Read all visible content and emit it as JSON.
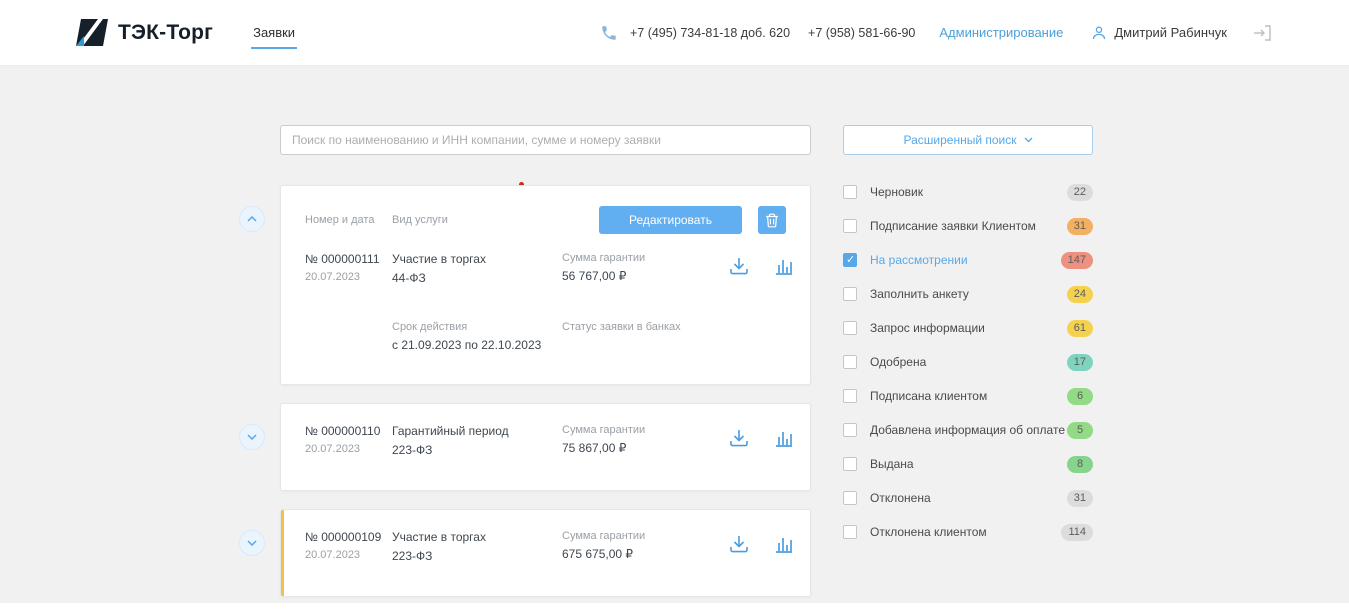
{
  "header": {
    "logo_text": "ТЭК-Торг",
    "nav_requests": "Заявки",
    "phone_1": "+7 (495) 734-81-18 доб. 620",
    "phone_2": "+7 (958) 581-66-90",
    "admin_link": "Администрирование",
    "user_name": "Дмитрий Рабинчук"
  },
  "search": {
    "placeholder": "Поиск по наименованию и ИНН компании, сумме и номеру заявки",
    "advanced_label": "Расширенный поиск"
  },
  "cards": [
    {
      "labels": {
        "number_date": "Номер и дата",
        "service_type": "Вид услуги"
      },
      "edit_label": "Редактировать",
      "number": "№ 000000111",
      "date": "20.07.2023",
      "service": "Участие в торгах",
      "law": "44-ФЗ",
      "sum_label": "Сумма гарантии",
      "sum": "56 767,00 ₽",
      "validity_label": "Срок действия",
      "validity": "с 21.09.2023 по 22.10.2023",
      "bank_status_label": "Статус заявки в банках"
    },
    {
      "number": "№ 000000110",
      "date": "20.07.2023",
      "service": "Гарантийный период",
      "law": "223-ФЗ",
      "sum_label": "Сумма гарантии",
      "sum": "75 867,00 ₽"
    },
    {
      "number": "№ 000000109",
      "date": "20.07.2023",
      "service": "Участие в торгах",
      "law": "223-ФЗ",
      "sum_label": "Сумма гарантии",
      "sum": "675 675,00 ₽",
      "accent_color": "#f0c24b"
    }
  ],
  "filters": {
    "items": [
      {
        "label": "Черновик",
        "count": "22",
        "badge_color": "#dcdcdc",
        "checked": false
      },
      {
        "label": "Подписание заявки Клиентом",
        "count": "31",
        "badge_color": "#f3b061",
        "checked": false
      },
      {
        "label": "На рассмотрении",
        "count": "147",
        "badge_color": "#ef9180",
        "checked": true
      },
      {
        "label": "Заполнить анкету",
        "count": "24",
        "badge_color": "#f5d24e",
        "checked": false
      },
      {
        "label": "Запрос информации",
        "count": "61",
        "badge_color": "#f5d24e",
        "checked": false
      },
      {
        "label": "Одобрена",
        "count": "17",
        "badge_color": "#7fd4bf",
        "checked": false
      },
      {
        "label": "Подписана клиентом",
        "count": "6",
        "badge_color": "#92da85",
        "checked": false
      },
      {
        "label": "Добавлена информация об оплате",
        "count": "5",
        "badge_color": "#92da85",
        "checked": false
      },
      {
        "label": "Выдана",
        "count": "8",
        "badge_color": "#85d58d",
        "checked": false
      },
      {
        "label": "Отклонена",
        "count": "31",
        "badge_color": "#dcdcdc",
        "checked": false
      },
      {
        "label": "Отклонена клиентом",
        "count": "114",
        "badge_color": "#dcdcdc",
        "checked": false
      }
    ]
  },
  "colors": {
    "accent": "#57a8e8",
    "button": "#61aef1",
    "notification_dot": "#cf2b1f",
    "card_accent": "#f0c24b"
  }
}
